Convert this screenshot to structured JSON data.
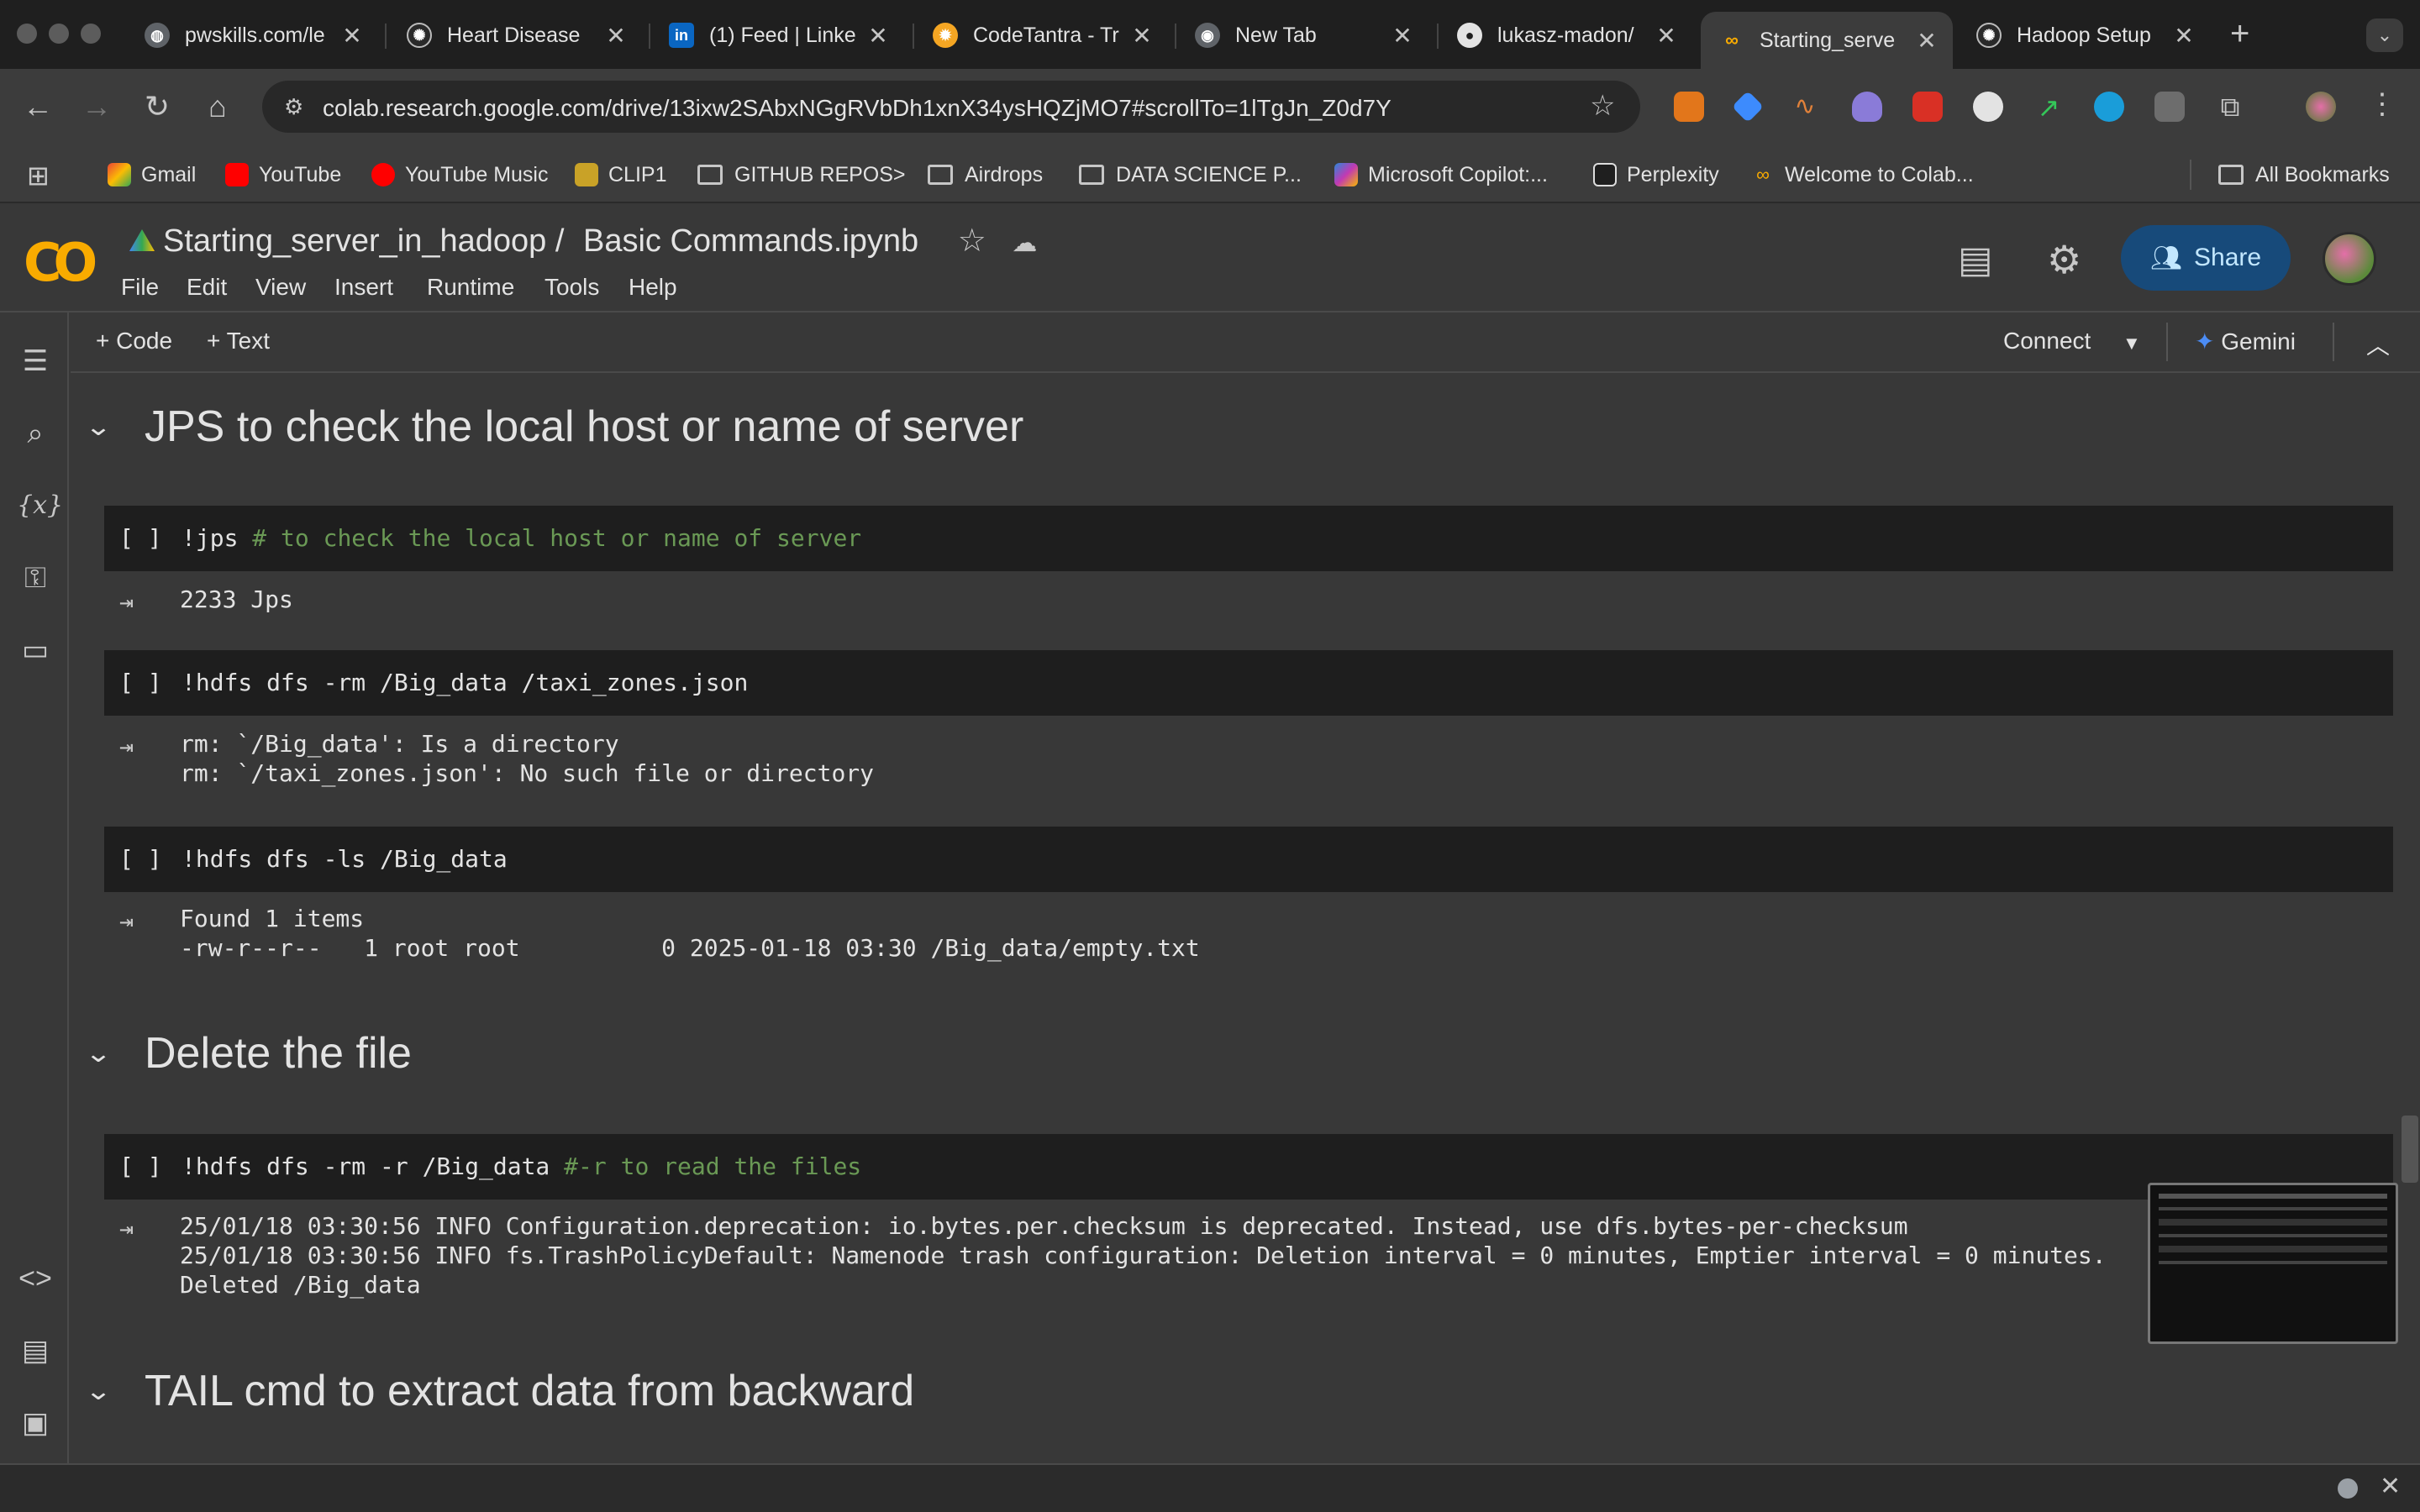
{
  "browser": {
    "tabs": [
      {
        "title": "pwskills.com/le",
        "icon": "globe-icon",
        "color": "#9aa0a6"
      },
      {
        "title": "Heart Disease",
        "icon": "openai-icon",
        "color": "#9aa0a6"
      },
      {
        "title": "(1) Feed | Linke",
        "icon": "linkedin-icon",
        "color": "#0a66c2"
      },
      {
        "title": "CodeTantra - Tr",
        "icon": "codetantra-icon",
        "color": "#f5a623"
      },
      {
        "title": "New Tab",
        "icon": "chrome-icon",
        "color": "#9aa0a6"
      },
      {
        "title": "lukasz-madon/",
        "icon": "github-icon",
        "color": "#e3e3e3"
      },
      {
        "title": "Starting_serve",
        "icon": "colab-icon",
        "color": "#f9ab00",
        "active": true
      },
      {
        "title": "Hadoop Setup",
        "icon": "openai-icon",
        "color": "#9aa0a6"
      }
    ],
    "url": "colab.research.google.com/drive/13ixw2SAbxNGgRVbDh1xnX34ysHQZjMO7#scrollTo=1lTgJn_Z0d7Y",
    "bookmarks": [
      {
        "label": "Gmail",
        "icon": "gmail-icon"
      },
      {
        "label": "YouTube",
        "icon": "youtube-icon"
      },
      {
        "label": "YouTube Music",
        "icon": "youtube-music-icon"
      },
      {
        "label": "CLIP1",
        "icon": "clip-icon"
      },
      {
        "label": "GITHUB REPOS>",
        "icon": "folder-icon"
      },
      {
        "label": "Airdrops",
        "icon": "folder-icon"
      },
      {
        "label": "DATA SCIENCE P...",
        "icon": "folder-icon"
      },
      {
        "label": "Microsoft Copilot:...",
        "icon": "copilot-icon"
      },
      {
        "label": "Perplexity",
        "icon": "perplexity-icon"
      },
      {
        "label": "Welcome to Colab...",
        "icon": "colab-icon"
      },
      {
        "label": "All Bookmarks",
        "icon": "folder-icon"
      }
    ]
  },
  "colab": {
    "logo": "CO",
    "notebook_folder": "Starting_server_in_hadoop /",
    "notebook_name": "Basic Commands.ipynb",
    "menu": [
      "File",
      "Edit",
      "View",
      "Insert",
      "Runtime",
      "Tools",
      "Help"
    ],
    "share_label": "Share",
    "add_code": "+ Code",
    "add_text": "+ Text",
    "connect_label": "Connect",
    "gemini_label": "Gemini"
  },
  "cells": {
    "h1": "JPS to check the local host or name of server",
    "c1_run": "[ ]",
    "c1_cmd": "!jps",
    "c1_comment": " # to check the local host or name of server",
    "o1": "2233 Jps",
    "c2_run": "[ ]",
    "c2_cmd": "!hdfs dfs -rm /Big_data /taxi_zones.json",
    "o2": "rm: `/Big_data': Is a directory\nrm: `/taxi_zones.json': No such file or directory",
    "c3_run": "[ ]",
    "c3_cmd": "!hdfs dfs -ls /Big_data",
    "o3": "Found 1 items\n-rw-r--r--   1 root root          0 2025-01-18 03:30 /Big_data/empty.txt",
    "h2": "Delete the file",
    "c4_run": "[ ]",
    "c4_cmd": "!hdfs dfs -rm -r /Big_data",
    "c4_comment": " #-r to read the files",
    "o4": "25/01/18 03:30:56 INFO Configuration.deprecation: io.bytes.per.checksum is deprecated. Instead, use dfs.bytes-per-checksum\n25/01/18 03:30:56 INFO fs.TrashPolicyDefault: Namenode trash configuration: Deletion interval = 0 minutes, Emptier interval = 0 minutes.\nDeleted /Big_data",
    "h3": "TAIL cmd to extract data from backward"
  }
}
